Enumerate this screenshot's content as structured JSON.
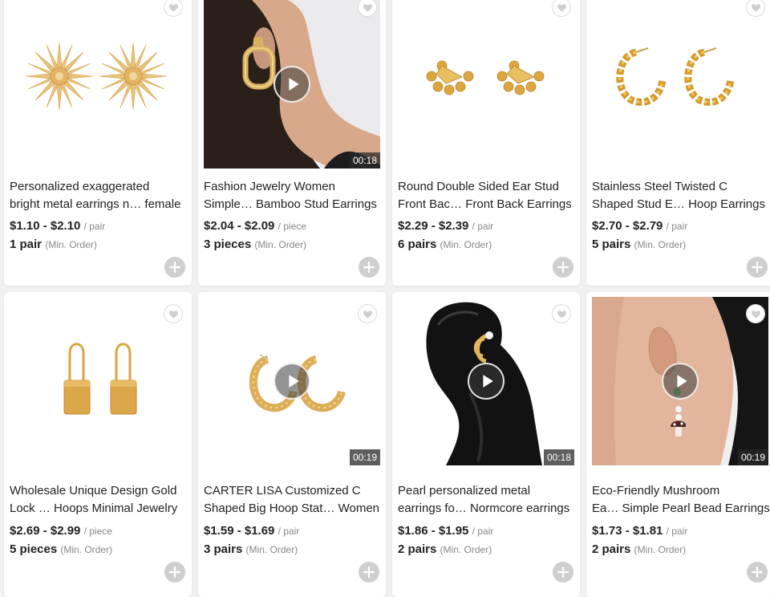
{
  "products": [
    {
      "title_line1": "Personalized exaggerated",
      "title_line2": "bright metal earrings n… female",
      "price": "$1.10 - $2.10",
      "unit": "/ pair",
      "moq": "1 pair",
      "moq_note": "(Min. Order)",
      "has_video": false,
      "duration": "",
      "image": "sunburst-studs"
    },
    {
      "title_line1": "Fashion Jewelry Women",
      "title_line2": "Simple… Bamboo Stud Earrings",
      "price": "$2.04 - $2.09",
      "unit": "/ piece",
      "moq": "3 pieces",
      "moq_note": "(Min. Order)",
      "has_video": true,
      "duration": "00:18",
      "image": "model-bamboo-earring"
    },
    {
      "title_line1": "Round Double Sided Ear Stud",
      "title_line2": "Front Bac… Front Back Earrings",
      "price": "$2.29 - $2.39",
      "unit": "/ pair",
      "moq": "6 pairs",
      "moq_note": "(Min. Order)",
      "has_video": false,
      "duration": "",
      "image": "ball-fan-studs"
    },
    {
      "title_line1": "Stainless Steel Twisted C",
      "title_line2": "Shaped Stud E… Hoop Earrings",
      "price": "$2.70 - $2.79",
      "unit": "/ pair",
      "moq": "5 pairs",
      "moq_note": "(Min. Order)",
      "has_video": false,
      "duration": "",
      "image": "twisted-hoops"
    },
    {
      "title_line1": "Wholesale Unique Design Gold",
      "title_line2": "Lock … Hoops Minimal Jewelry",
      "price": "$2.69 - $2.99",
      "unit": "/ piece",
      "moq": "5 pieces",
      "moq_note": "(Min. Order)",
      "has_video": false,
      "duration": "",
      "image": "padlock-earrings"
    },
    {
      "title_line1": "CARTER LISA Customized C",
      "title_line2": "Shaped Big Hoop Stat… Women",
      "price": "$1.59 - $1.69",
      "unit": "/ pair",
      "moq": "3 pairs",
      "moq_note": "(Min. Order)",
      "has_video": true,
      "duration": "00:19",
      "image": "textured-c-hoops"
    },
    {
      "title_line1": "Pearl personalized metal",
      "title_line2": "earrings fo… Normcore earrings",
      "price": "$1.86 - $1.95",
      "unit": "/ pair",
      "moq": "2 pairs",
      "moq_note": "(Min. Order)",
      "has_video": true,
      "duration": "00:18",
      "image": "black-bust-earring"
    },
    {
      "title_line1": "Eco-Friendly Mushroom",
      "title_line2": "Ea… Simple Pearl Bead Earrings",
      "price": "$1.73 - $1.81",
      "unit": "/ pair",
      "moq": "2 pairs",
      "moq_note": "(Min. Order)",
      "has_video": true,
      "duration": "00:19",
      "image": "model-mushroom-earring"
    }
  ],
  "icons": {
    "favorite": "heart-icon",
    "add": "plus-icon",
    "play": "play-icon"
  },
  "colors": {
    "gold": "#d9a640",
    "video_overlay": "#3c3c3c"
  }
}
